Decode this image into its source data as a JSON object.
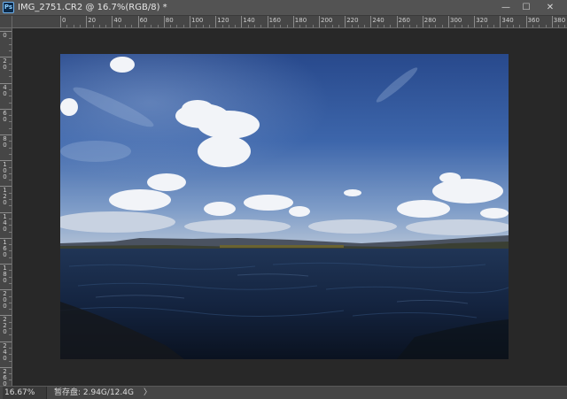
{
  "titlebar": {
    "app_icon_label": "Ps",
    "document_title": "IMG_2751.CR2 @ 16.7%(RGB/8) *",
    "minimize_glyph": "—",
    "maximize_glyph": "☐",
    "close_glyph": "✕"
  },
  "ruler": {
    "horizontal_labels": [
      "0",
      "20",
      "40",
      "60",
      "80",
      "100",
      "120",
      "140",
      "160",
      "180",
      "200",
      "220",
      "240",
      "260",
      "280",
      "300",
      "320",
      "340",
      "360",
      "380"
    ],
    "vertical_labels": [
      "20",
      "0",
      "20",
      "40",
      "60",
      "80",
      "100",
      "120",
      "140",
      "160",
      "180",
      "200",
      "220",
      "240",
      "260",
      "280"
    ]
  },
  "canvas": {
    "image_description_name": "lake-landscape-photo",
    "colors": {
      "sky_top": "#2a4f94",
      "sky_mid": "#3f6ab0",
      "sky_horizon": "#9fb4d0",
      "water_top": "#1b2c48",
      "water_bottom": "#0b1424",
      "hills": "#3d4652",
      "shore": "#5a5a2a"
    }
  },
  "statusbar": {
    "zoom": "16.67%",
    "doc_info": "暂存盘: 2.94G/12.4G",
    "menu_arrow": "〉"
  }
}
